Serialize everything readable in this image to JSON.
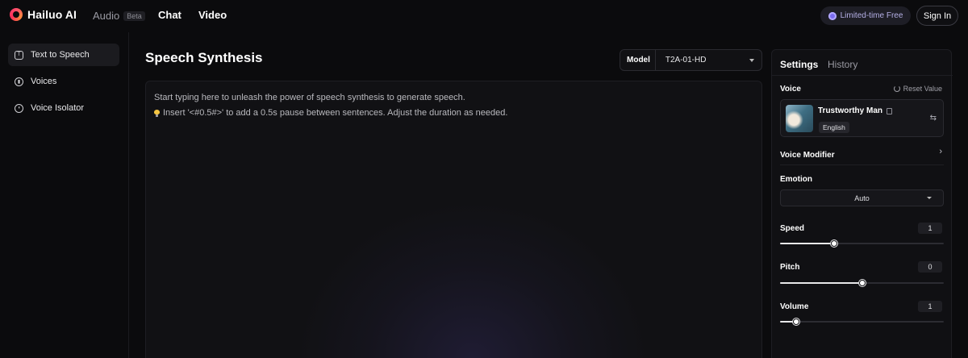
{
  "brand": {
    "name": "Hailuo AI"
  },
  "nav": {
    "audio": "Audio",
    "audio_badge": "Beta",
    "chat": "Chat",
    "video": "Video"
  },
  "header": {
    "promo": "Limited-time Free",
    "signin": "Sign In"
  },
  "sidebar": {
    "items": [
      {
        "label": "Text to Speech",
        "icon": "text-speech-icon",
        "active": true
      },
      {
        "label": "Voices",
        "icon": "voices-icon",
        "active": false
      },
      {
        "label": "Voice Isolator",
        "icon": "voice-isolator-icon",
        "active": false
      }
    ]
  },
  "main": {
    "title": "Speech Synthesis",
    "model_label": "Model",
    "model_value": "T2A-01-HD",
    "editor_placeholder": "Start typing here to unleash the power of speech synthesis to generate speech.",
    "editor_tip": "Insert '<#0.5#>' to add a 0.5s pause between sentences. Adjust the duration as needed."
  },
  "panel": {
    "tabs": [
      "Settings",
      "History"
    ],
    "voice_label": "Voice",
    "reset_label": "Reset Value",
    "voice_name": "Trustworthy Man",
    "voice_language": "English",
    "modifier_label": "Voice Modifier",
    "emotion_label": "Emotion",
    "emotion_value": "Auto",
    "speed_label": "Speed",
    "speed_value": "1",
    "speed_level": 0.33,
    "pitch_label": "Pitch",
    "pitch_value": "0",
    "pitch_level": 0.5,
    "volume_label": "Volume",
    "volume_value": "1",
    "volume_level": 0.1
  },
  "colors": {
    "background": "#0b0b0d",
    "panel": "#101013",
    "accent": "#7b6cf0"
  }
}
